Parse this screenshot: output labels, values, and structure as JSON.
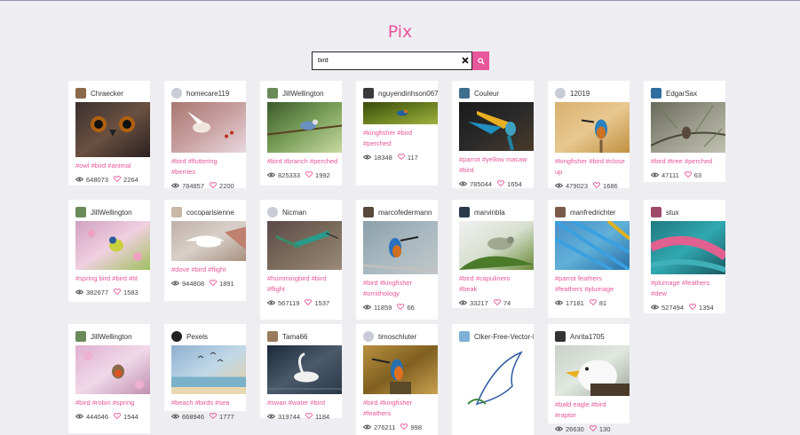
{
  "app": {
    "title": "Pix"
  },
  "search": {
    "value": "bird",
    "clear_icon": "close-icon",
    "submit_icon": "search-icon"
  },
  "colors": {
    "accent": "#e8569b",
    "background": "#eeeef2"
  },
  "cards": [
    {
      "author": "Chraecker",
      "tags": "#owl #bird #animal",
      "views": "648073",
      "likes": "2264"
    },
    {
      "author": "homecare119",
      "tags": "#bird #fluttering #berries",
      "views": "784857",
      "likes": "2200"
    },
    {
      "author": "JillWellington",
      "tags": "#bird #branch #perched",
      "views": "825333",
      "likes": "1992"
    },
    {
      "author": "nguyendinhson067",
      "tags": "#kingfisher #bird #perched",
      "views": "18348",
      "likes": "117"
    },
    {
      "author": "Couleur",
      "tags": "#parrot #yellow macaw #bird",
      "views": "785044",
      "likes": "1654"
    },
    {
      "author": "12019",
      "tags": "#kingfisher #bird #close up",
      "views": "479023",
      "likes": "1686"
    },
    {
      "author": "EdgarSax",
      "tags": "#bird #tree #perched",
      "views": "47111",
      "likes": "63"
    },
    {
      "author": "JillWellington",
      "tags": "#spring bird #bird #tit",
      "views": "382677",
      "likes": "1583"
    },
    {
      "author": "cocoparisienne",
      "tags": "#dove #bird #flight",
      "views": "944808",
      "likes": "1891"
    },
    {
      "author": "Nicman",
      "tags": "#hummingbird #bird #flight",
      "views": "567119",
      "likes": "1537"
    },
    {
      "author": "marcofedermann",
      "tags": "#bird #kingfisher #ornithology",
      "views": "11859",
      "likes": "66"
    },
    {
      "author": "marvinbla",
      "tags": "#bird #capulinero #beak",
      "views": "33217",
      "likes": "74"
    },
    {
      "author": "manfredrichter",
      "tags": "#parrot feathers #feathers #plumage",
      "views": "17181",
      "likes": "81"
    },
    {
      "author": "stux",
      "tags": "#plumage #feathers #dew",
      "views": "527494",
      "likes": "1354"
    },
    {
      "author": "JillWellington",
      "tags": "#bird #robin #spring",
      "views": "444046",
      "likes": "1544"
    },
    {
      "author": "Pexels",
      "tags": "#beach #birds #sea",
      "views": "668946",
      "likes": "1777"
    },
    {
      "author": "Tama66",
      "tags": "#swan #water #bird",
      "views": "319744",
      "likes": "1184"
    },
    {
      "author": "timoschluter",
      "tags": "#bird #kingfisher #feathers",
      "views": "276211",
      "likes": "998"
    },
    {
      "author": "Clker-Free-Vector-Images",
      "tags": "",
      "views": "",
      "likes": ""
    },
    {
      "author": "Anrita1705",
      "tags": "#bald eagle #bird #raptor",
      "views": "26630",
      "likes": "130"
    }
  ]
}
